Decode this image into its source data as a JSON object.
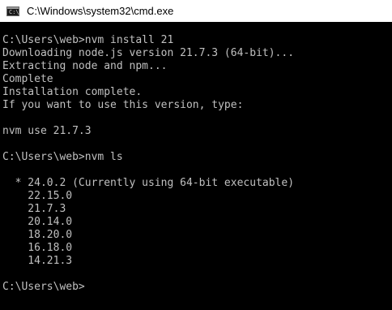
{
  "window": {
    "title": "C:\\Windows\\system32\\cmd.exe",
    "icon_name": "cmd-console-icon",
    "icon_glyph": "C:\\"
  },
  "console": {
    "lines": [
      "C:\\Users\\web>nvm install 21",
      "Downloading node.js version 21.7.3 (64-bit)...",
      "Extracting node and npm...",
      "Complete",
      "Installation complete.",
      "If you want to use this version, type:",
      "",
      "nvm use 21.7.3",
      "",
      "C:\\Users\\web>nvm ls",
      "",
      "  * 24.0.2 (Currently using 64-bit executable)",
      "    22.15.0",
      "    21.7.3",
      "    20.14.0",
      "    18.20.0",
      "    16.18.0",
      "    14.21.3",
      "",
      "C:\\Users\\web>"
    ]
  },
  "colors": {
    "console_background": "#000000",
    "console_text": "#c0c0c0",
    "titlebar_background": "#ffffff",
    "titlebar_text": "#000000"
  }
}
